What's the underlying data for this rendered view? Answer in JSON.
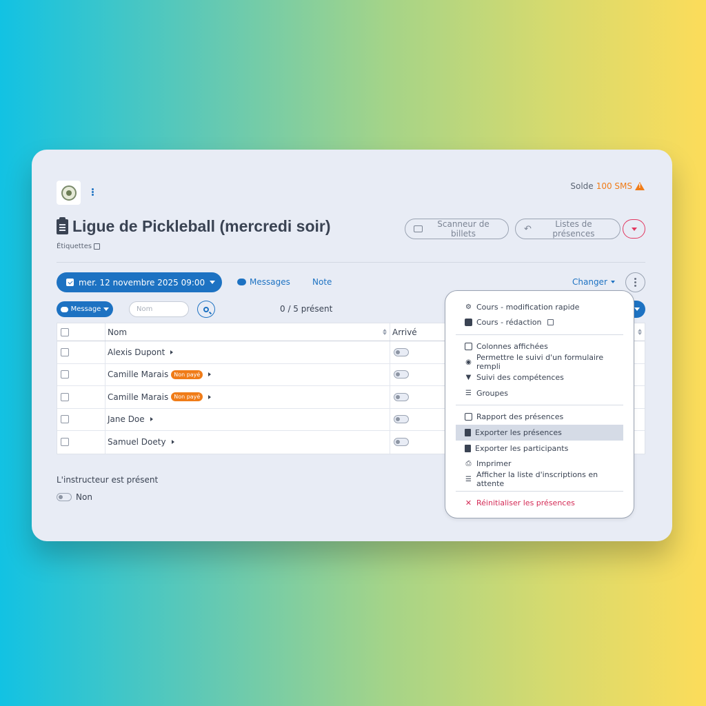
{
  "header": {
    "solde_label": "Solde",
    "solde_value": "100 SMS",
    "title": "Ligue de Pickleball (mercredi soir)",
    "tags_label": "Étiquettes"
  },
  "actions": {
    "scanner": "Scanneur de billets",
    "lists": "Listes de présences"
  },
  "toolbar": {
    "date": "mer. 12 novembre 2025 09:00",
    "messages": "Messages",
    "note": "Note",
    "changer": "Changer"
  },
  "filters": {
    "message_btn": "Message",
    "search_placeholder": "Nom",
    "present_count": "0 / 5 présent"
  },
  "table": {
    "col_name": "Nom",
    "col_arrived": "Arrivé",
    "rows": [
      {
        "name": "Alexis Dupont",
        "badge": ""
      },
      {
        "name": "Camille Marais",
        "badge": "Non payé"
      },
      {
        "name": "Camille Marais",
        "badge": "Non payé"
      },
      {
        "name": "Jane Doe",
        "badge": ""
      },
      {
        "name": "Samuel Doety",
        "badge": ""
      }
    ]
  },
  "instructor": {
    "label": "L'instructeur est présent",
    "value": "Non"
  },
  "menu": {
    "items": [
      "Cours - modification rapide",
      "Cours - rédaction",
      "Colonnes affichées",
      "Permettre le suivi d'un formulaire rempli",
      "Suivi des compétences",
      "Groupes",
      "Rapport des présences",
      "Exporter les présences",
      "Exporter les participants",
      "Imprimer",
      "Afficher la liste d'inscriptions en attente",
      "Réinitialiser les présences"
    ]
  },
  "colors": {
    "primary": "#1d72c2",
    "warning": "#f07c18",
    "danger": "#d42a55",
    "text": "#3a4353"
  }
}
